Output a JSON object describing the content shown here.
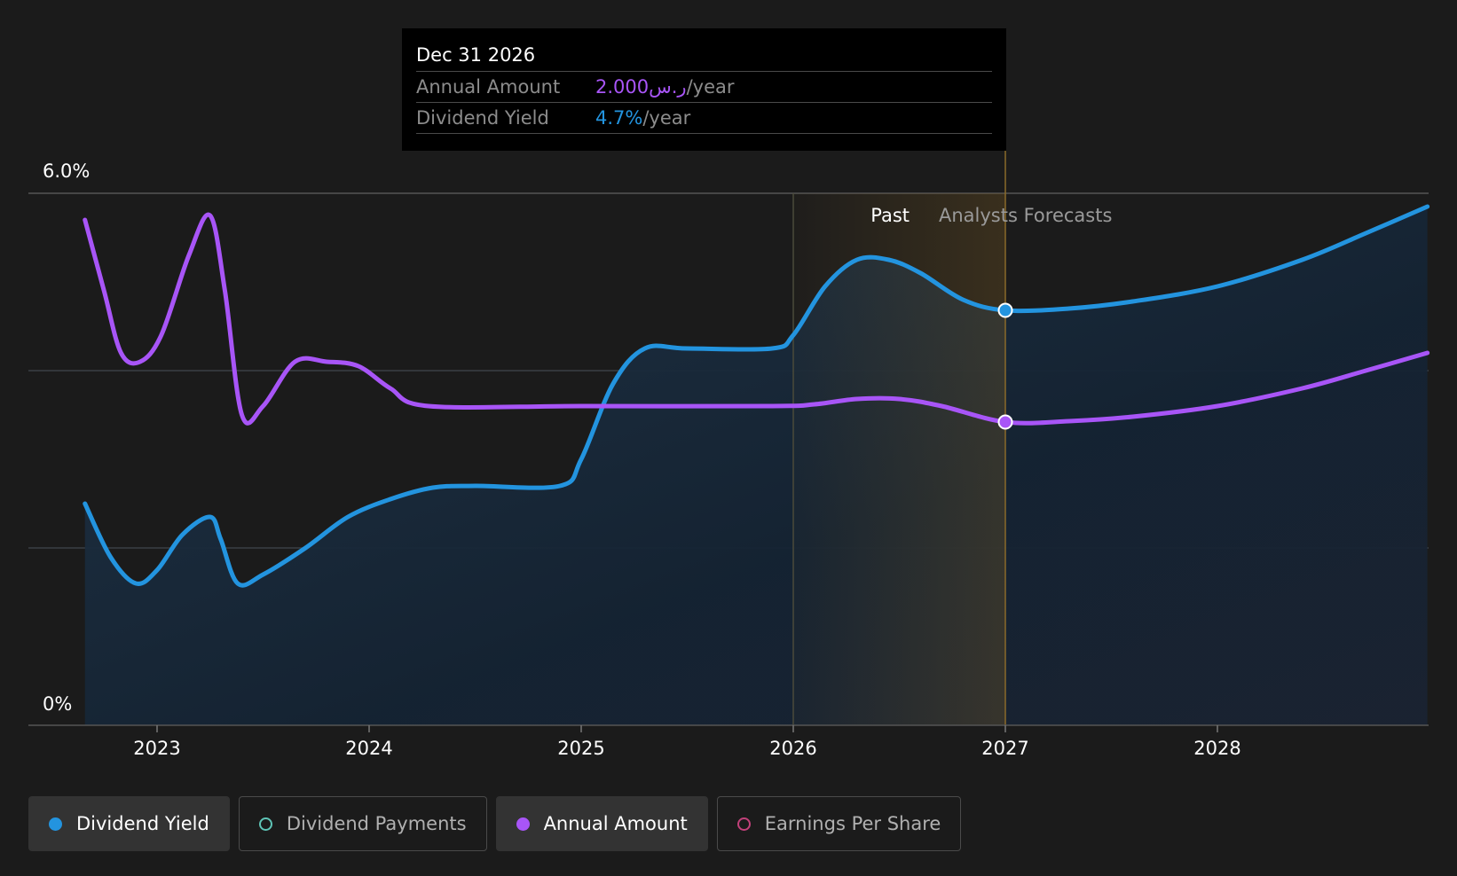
{
  "chart_data": {
    "type": "line",
    "y_axis": {
      "top_label": "6.0%",
      "bottom_label": "0%",
      "ylim": [
        0,
        6
      ]
    },
    "x_ticks": [
      "2023",
      "2024",
      "2025",
      "2026",
      "2027",
      "2028"
    ],
    "regions": {
      "past_label": "Past",
      "forecast_label": "Analysts Forecasts"
    },
    "grid": true,
    "series": [
      {
        "name": "Dividend Yield",
        "color": "#2394df",
        "area": true,
        "points": [
          [
            2022.66,
            2.5
          ],
          [
            2022.78,
            1.9
          ],
          [
            2022.9,
            1.6
          ],
          [
            2023.0,
            1.75
          ],
          [
            2023.12,
            2.15
          ],
          [
            2023.25,
            2.35
          ],
          [
            2023.3,
            2.1
          ],
          [
            2023.38,
            1.6
          ],
          [
            2023.5,
            1.7
          ],
          [
            2023.7,
            2.0
          ],
          [
            2023.9,
            2.35
          ],
          [
            2024.1,
            2.55
          ],
          [
            2024.3,
            2.68
          ],
          [
            2024.5,
            2.7
          ],
          [
            2024.9,
            2.7
          ],
          [
            2025.0,
            3.0
          ],
          [
            2025.15,
            3.85
          ],
          [
            2025.3,
            4.25
          ],
          [
            2025.5,
            4.25
          ],
          [
            2025.9,
            4.25
          ],
          [
            2026.0,
            4.4
          ],
          [
            2026.15,
            4.95
          ],
          [
            2026.3,
            5.25
          ],
          [
            2026.45,
            5.25
          ],
          [
            2026.6,
            5.1
          ],
          [
            2026.8,
            4.8
          ],
          [
            2027.0,
            4.68
          ],
          [
            2027.3,
            4.7
          ],
          [
            2027.6,
            4.78
          ],
          [
            2028.0,
            4.95
          ],
          [
            2028.4,
            5.25
          ],
          [
            2028.7,
            5.55
          ],
          [
            2028.99,
            5.85
          ]
        ]
      },
      {
        "name": "Annual Amount",
        "color": "#a855f7",
        "area": false,
        "points": [
          [
            2022.66,
            5.7
          ],
          [
            2022.75,
            4.9
          ],
          [
            2022.83,
            4.2
          ],
          [
            2022.92,
            4.1
          ],
          [
            2023.02,
            4.4
          ],
          [
            2023.15,
            5.3
          ],
          [
            2023.25,
            5.75
          ],
          [
            2023.32,
            4.9
          ],
          [
            2023.4,
            3.5
          ],
          [
            2023.5,
            3.6
          ],
          [
            2023.65,
            4.1
          ],
          [
            2023.8,
            4.1
          ],
          [
            2023.95,
            4.05
          ],
          [
            2024.1,
            3.8
          ],
          [
            2024.28,
            3.6
          ],
          [
            2025.0,
            3.6
          ],
          [
            2025.9,
            3.6
          ],
          [
            2026.1,
            3.62
          ],
          [
            2026.3,
            3.68
          ],
          [
            2026.5,
            3.68
          ],
          [
            2026.7,
            3.6
          ],
          [
            2027.0,
            3.42
          ],
          [
            2027.3,
            3.43
          ],
          [
            2027.6,
            3.48
          ],
          [
            2028.0,
            3.6
          ],
          [
            2028.4,
            3.8
          ],
          [
            2028.7,
            4.0
          ],
          [
            2028.99,
            4.2
          ]
        ]
      }
    ],
    "legend": [
      {
        "name": "Dividend Yield",
        "color": "#2394df",
        "filled": true,
        "active": true
      },
      {
        "name": "Dividend Payments",
        "color": "#5ec4b6",
        "filled": false,
        "active": false
      },
      {
        "name": "Annual Amount",
        "color": "#a855f7",
        "filled": true,
        "active": true
      },
      {
        "name": "Earnings Per Share",
        "color": "#c2417a",
        "filled": false,
        "active": false
      }
    ],
    "tooltip": {
      "date": "Dec 31 2026",
      "rows": [
        {
          "label": "Annual Amount",
          "value": "2.000ر.س",
          "unit": "/year"
        },
        {
          "label": "Dividend Yield",
          "value": "4.7%",
          "unit": "/year"
        }
      ]
    }
  }
}
